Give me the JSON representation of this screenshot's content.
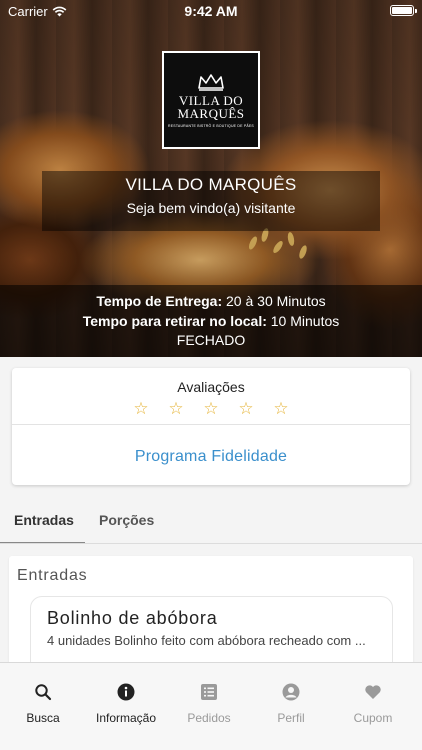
{
  "status_bar": {
    "carrier": "Carrier",
    "time": "9:42 AM"
  },
  "hero": {
    "logo": {
      "line1": "VILLA DO",
      "line2": "MARQUÊS",
      "tagline": "RESTAURANTE BISTRÔ E BOUTIQUE DE PÃES"
    },
    "restaurant_name": "VILLA DO MARQUÊS",
    "welcome": "Seja bem vindo(a) visitante",
    "delivery_label": "Tempo de Entrega:",
    "delivery_value": " 20 à 30 Minutos",
    "pickup_label": "Tempo para retirar no local:",
    "pickup_value": " 10 Minutos",
    "status": "FECHADO"
  },
  "card": {
    "ratings_title": "Avaliações",
    "stars": [
      "☆",
      "☆",
      "☆",
      "☆",
      "☆"
    ],
    "loyalty_label": "Programa Fidelidade",
    "loyalty_color": "#3a8fcc"
  },
  "tabs": [
    {
      "label": "Entradas",
      "active": true
    },
    {
      "label": "Porções",
      "active": false
    }
  ],
  "section": {
    "title": "Entradas",
    "products": [
      {
        "name": "Bolinho de abóbora",
        "description": "4 unidades Bolinho feito com abóbora recheado com ..."
      }
    ]
  },
  "bottom_nav": [
    {
      "label": "Busca",
      "icon": "search-icon",
      "active": true
    },
    {
      "label": "Informação",
      "icon": "info-icon",
      "active": true
    },
    {
      "label": "Pedidos",
      "icon": "orders-icon",
      "active": false
    },
    {
      "label": "Perfil",
      "icon": "profile-icon",
      "active": false
    },
    {
      "label": "Cupom",
      "icon": "heart-icon",
      "active": false
    }
  ]
}
